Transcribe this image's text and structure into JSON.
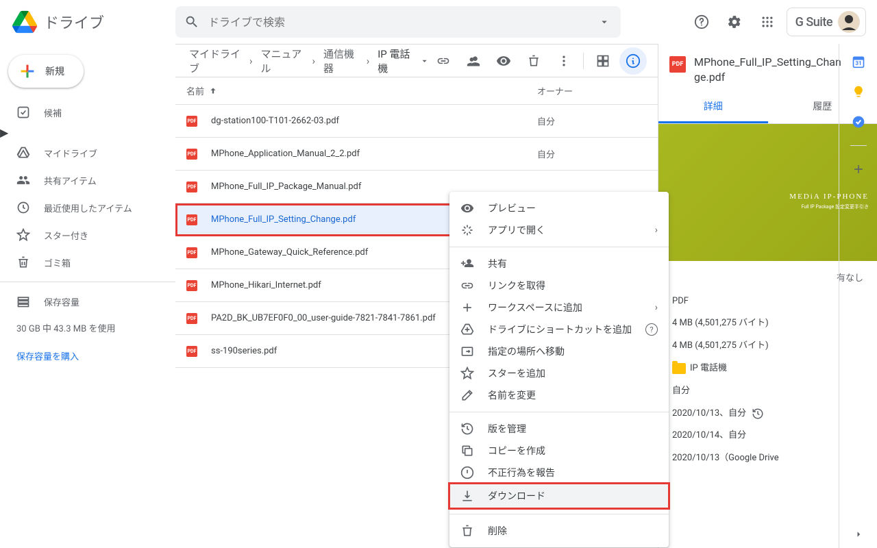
{
  "app": {
    "name": "ドライブ"
  },
  "search": {
    "placeholder": "ドライブで検索"
  },
  "gsuite": "G Suite",
  "sidebar": {
    "new_label": "新規",
    "items": [
      {
        "label": "候補"
      },
      {
        "label": "マイドライブ"
      },
      {
        "label": "共有アイテム"
      },
      {
        "label": "最近使用したアイテム"
      },
      {
        "label": "スター付き"
      },
      {
        "label": "ゴミ箱"
      }
    ],
    "storage_label": "保存容量",
    "storage_used": "30 GB 中 43.3 MB を使用",
    "buy_storage": "保存容量を購入"
  },
  "breadcrumb": [
    "マイドライブ",
    "マニュアル",
    "通信機器",
    "IP 電話機"
  ],
  "list": {
    "col_name": "名前",
    "col_owner": "オーナー",
    "rows": [
      {
        "name": "dg-station100-T101-2662-03.pdf",
        "owner": "自分"
      },
      {
        "name": "MPhone_Application_Manual_2_2.pdf",
        "owner": "自分"
      },
      {
        "name": "MPhone_Full_IP_Package_Manual.pdf",
        "owner": ""
      },
      {
        "name": "MPhone_Full_IP_Setting_Change.pdf",
        "owner": ""
      },
      {
        "name": "MPhone_Gateway_Quick_Reference.pdf",
        "owner": ""
      },
      {
        "name": "MPhone_Hikari_Internet.pdf",
        "owner": ""
      },
      {
        "name": "PA2D_BK_UB7EF0F0_00_user-guide-7821-7841-7861.pdf",
        "owner": ""
      },
      {
        "name": "ss-190series.pdf",
        "owner": ""
      }
    ],
    "pdf_badge": "PDF"
  },
  "context_menu": {
    "preview": "プレビュー",
    "open_with": "アプリで開く",
    "share": "共有",
    "get_link": "リンクを取得",
    "add_workspace": "ワークスペースに追加",
    "add_shortcut": "ドライブにショートカットを追加",
    "move": "指定の場所へ移動",
    "star": "スターを追加",
    "rename": "名前を変更",
    "manage_versions": "版を管理",
    "copy": "コピーを作成",
    "report": "不正行為を報告",
    "download": "ダウンロード",
    "delete": "削除"
  },
  "details": {
    "title": "MPhone_Full_IP_Setting_Change.pdf",
    "tab_detail": "詳細",
    "tab_history": "履歴",
    "preview_brand": "MEDiA IP-PHONE",
    "preview_sub": "Full IP Package 設定変更手引き",
    "no_share": "有なし",
    "type": "PDF",
    "size1": "4 MB (4,501,275 バイト)",
    "size2": "4 MB (4,501,275 バイト)",
    "folder": "IP 電話機",
    "owner_label": "自分",
    "date1": "2020/10/13、自分",
    "date2": "2020/10/14、自分",
    "date3": "2020/10/13（Google Drive"
  }
}
